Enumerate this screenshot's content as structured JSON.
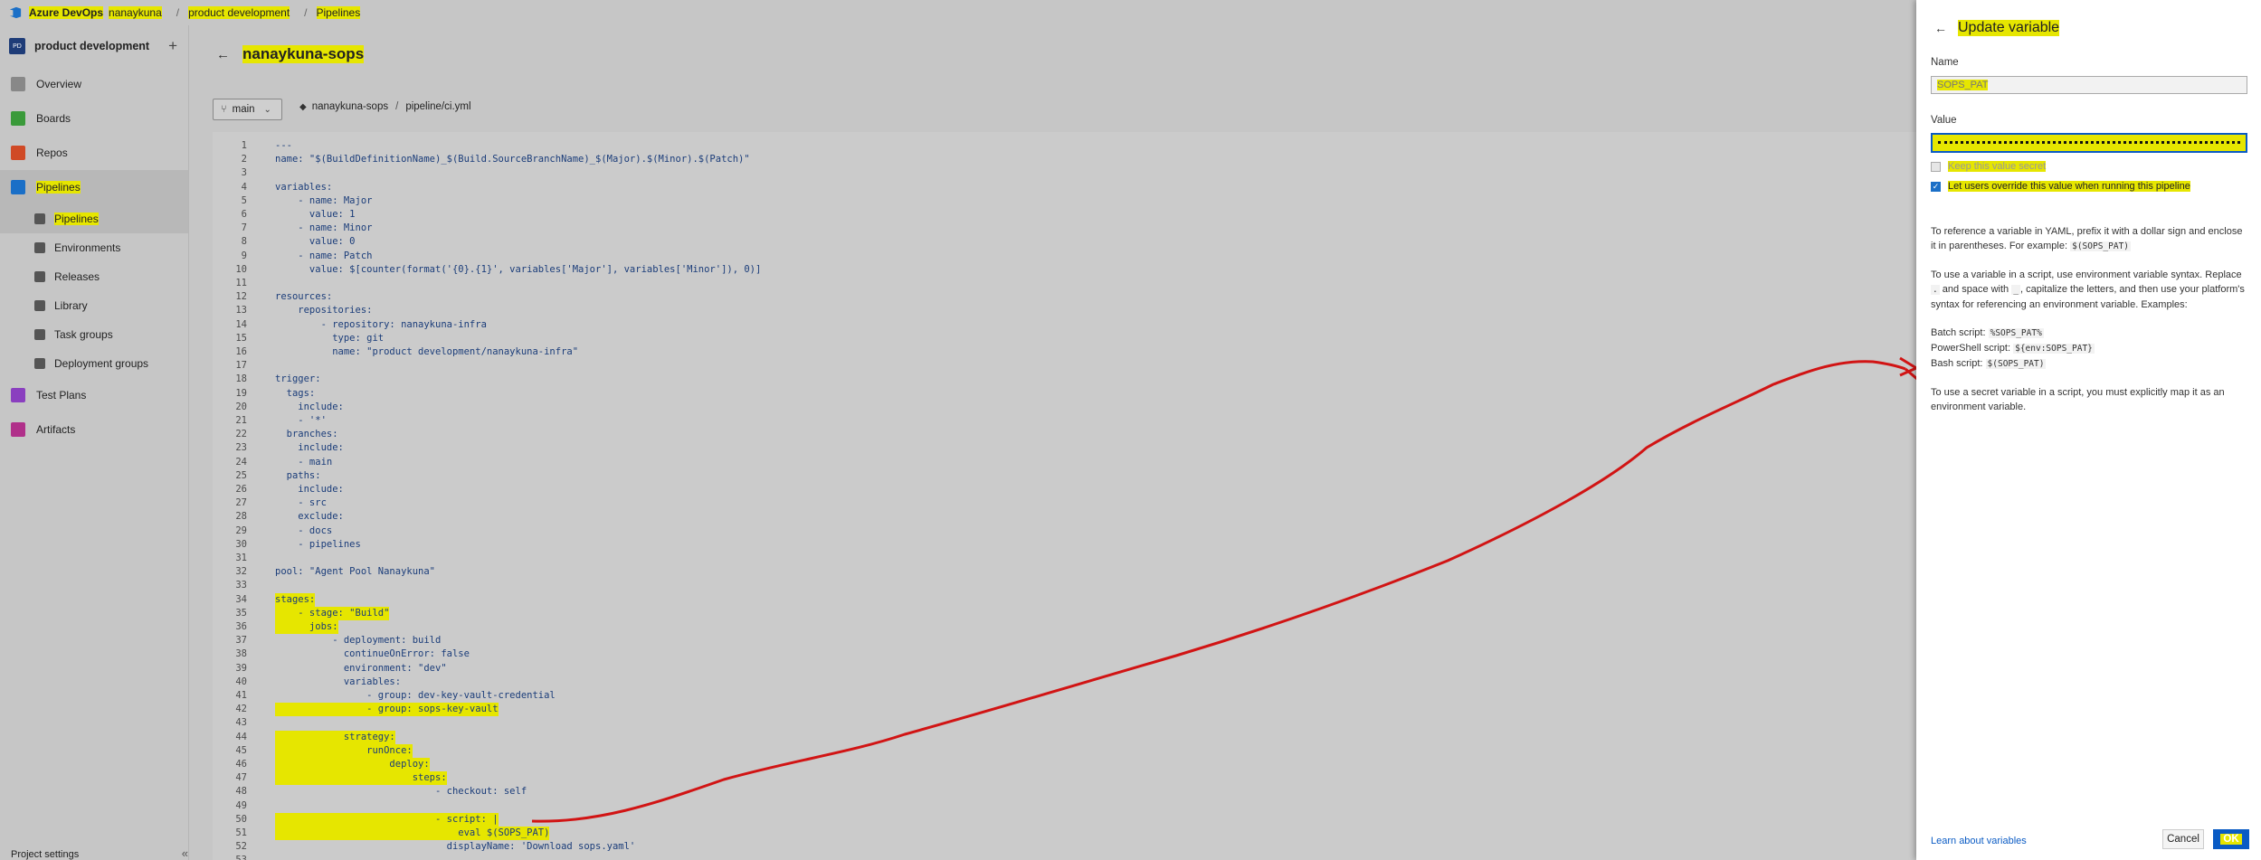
{
  "topbar": {
    "brand": "Azure DevOps",
    "breadcrumbs": [
      "nanaykuna",
      "product development",
      "Pipelines"
    ]
  },
  "sidebar": {
    "project_initials": "PD",
    "project_name": "product development",
    "add_label": "+",
    "items": [
      {
        "label": "Overview",
        "icon": "overview-icon",
        "color": "#888888"
      },
      {
        "label": "Boards",
        "icon": "boards-icon",
        "color": "#3a9a3a"
      },
      {
        "label": "Repos",
        "icon": "repos-icon",
        "color": "#d04a26"
      },
      {
        "label": "Pipelines",
        "icon": "pipelines-icon",
        "color": "#1a6fc7"
      },
      {
        "label": "Pipelines",
        "icon": "pipelines-sub-icon"
      },
      {
        "label": "Environments",
        "icon": "environments-icon"
      },
      {
        "label": "Releases",
        "icon": "releases-icon"
      },
      {
        "label": "Library",
        "icon": "library-icon"
      },
      {
        "label": "Task groups",
        "icon": "task-groups-icon"
      },
      {
        "label": "Deployment groups",
        "icon": "deployment-groups-icon"
      },
      {
        "label": "Test Plans",
        "icon": "test-plans-icon",
        "color": "#8a3fbf"
      },
      {
        "label": "Artifacts",
        "icon": "artifacts-icon",
        "color": "#b0308a"
      }
    ],
    "settings_label": "Project settings",
    "collapse_label": "«"
  },
  "main": {
    "back_label": "←",
    "title": "nanaykuna-sops",
    "branch": "main",
    "repo": "nanaykuna-sops",
    "file_path": "pipeline/ci.yml"
  },
  "code_lines": [
    "---",
    "name: \"$(BuildDefinitionName)_$(Build.SourceBranchName)_$(Major).$(Minor).$(Patch)\"",
    "",
    "variables:",
    "    - name: Major",
    "      value: 1",
    "    - name: Minor",
    "      value: 0",
    "    - name: Patch",
    "      value: $[counter(format('{0}.{1}', variables['Major'], variables['Minor']), 0)]",
    "",
    "resources:",
    "    repositories:",
    "        - repository: nanaykuna-infra",
    "          type: git",
    "          name: \"product development/nanaykuna-infra\"",
    "",
    "trigger:",
    "  tags:",
    "    include:",
    "    - '*'",
    "  branches:",
    "    include:",
    "    - main",
    "  paths:",
    "    include:",
    "    - src",
    "    exclude:",
    "    - docs",
    "    - pipelines",
    "",
    "pool: \"Agent Pool Nanaykuna\"",
    "",
    "stages:",
    "    - stage: \"Build\"",
    "      jobs:",
    "          - deployment: build",
    "            continueOnError: false",
    "            environment: \"dev\"",
    "            variables:",
    "                - group: dev-key-vault-credential",
    "                - group: sops-key-vault",
    "",
    "            strategy:",
    "                runOnce:",
    "                    deploy:",
    "                        steps:",
    "                            - checkout: self",
    "",
    "                            - script: |",
    "                                eval $(SOPS_PAT)",
    "                              displayName: 'Download sops.yaml'",
    ""
  ],
  "panel": {
    "back_label": "←",
    "title": "Update variable",
    "name_label": "Name",
    "name_value": "SOPS_PAT",
    "value_label": "Value",
    "keep_secret_label": "Keep this value secret",
    "override_label": "Let users override this value when running this pipeline",
    "check_mark": "✓",
    "info1": "To reference a variable in YAML, prefix it with a dollar sign and enclose it in parentheses. For example:",
    "info1_code": "$(SOPS_PAT)",
    "info2_a": "To use a variable in a script, use environment variable syntax. Replace",
    "info2_code1": ".",
    "info2_b": "and space with",
    "info2_code2": "_",
    "info2_c": ", capitalize the letters, and then use your platform's syntax for referencing an environment variable. Examples:",
    "batch_label": "Batch script:",
    "batch_code": "%SOPS_PAT%",
    "ps_label": "PowerShell script:",
    "ps_code": "${env:SOPS_PAT}",
    "bash_label": "Bash script:",
    "bash_code": "$(SOPS_PAT)",
    "info3": "To use a secret variable in a script, you must explicitly map it as an environment variable.",
    "learn_label": "Learn about variables",
    "cancel_label": "Cancel",
    "ok_label": "OK"
  }
}
